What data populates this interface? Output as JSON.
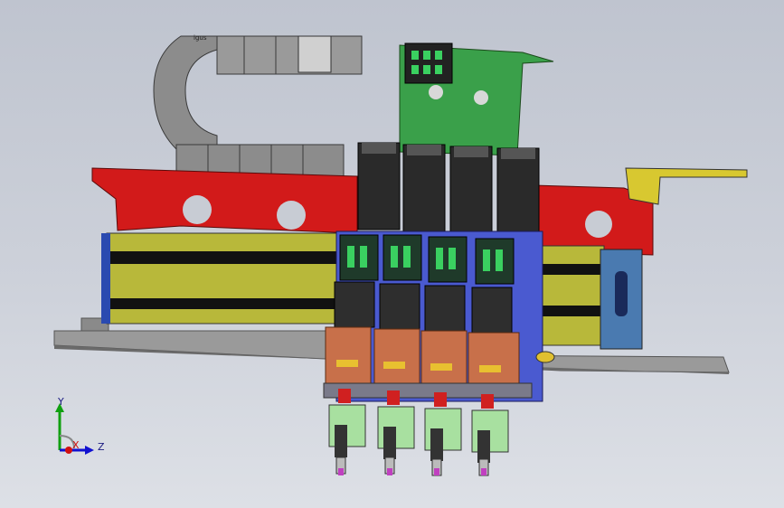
{
  "viewport": {
    "background_top": "#bfc4cf",
    "background_bottom": "#dde0e6"
  },
  "model": {
    "colors": {
      "frame_red": "#d21a1a",
      "rail_yellow": "#b8b83a",
      "plate_gray": "#9a9a9a",
      "pcb_green": "#3aa04a",
      "motor_black": "#2a2a2a",
      "bracket_blue": "#4a5ad0",
      "coupling_copper": "#c8704a",
      "nozzle_holder_green": "#a8e0a0",
      "cable_chain_gray": "#8c8c8c",
      "endplate_blue": "#4a7ab0",
      "side_bracket_yellow": "#d8c830"
    },
    "heads": 4
  },
  "cable_chain": {
    "link_label": "igus"
  },
  "triad": {
    "x_label": "X",
    "y_label": "Y",
    "z_label": "Z",
    "x_color": "#d01010",
    "y_color": "#10a010",
    "z_color": "#1010d0"
  }
}
